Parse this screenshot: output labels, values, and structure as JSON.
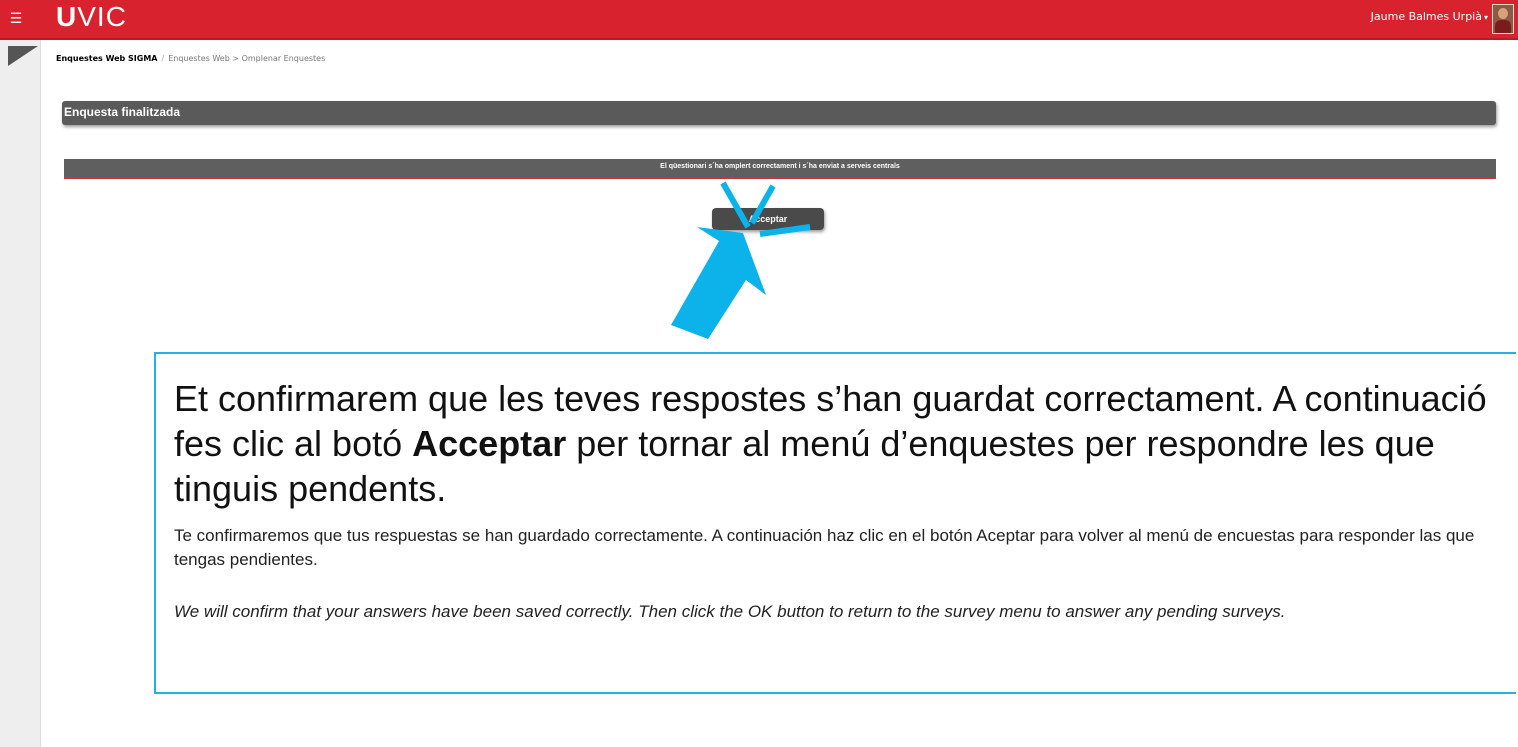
{
  "header": {
    "menu_icon": "hamburger-icon",
    "logo_u": "U",
    "logo_rest": "VIC",
    "user_name": "Jaume Balmes Urpià",
    "user_caret": "▾",
    "brand_color": "#d8232e"
  },
  "breadcrumb": {
    "home": "Enquestes Web SIGMA",
    "separator": "/",
    "path": "Enquestes Web > Omplenar Enquestes"
  },
  "panel": {
    "title": "Enquesta finalitzada",
    "notice": "El qüestionari s´ha omplert correctament i s´ha enviat a serveis centrals",
    "accept_label": "Acceptar"
  },
  "callout": {
    "catalan_part1": "Et confirmarem que les teves respostes s’han guardat correctament. A continuació fes clic al botó ",
    "catalan_bold": "Acceptar",
    "catalan_part2": " per tornar al menú d’enquestes per respondre les que tinguis pendents.",
    "spanish": "Te confirmaremos que tus respuestas se han guardado correctamente. A continuación haz clic en el botón Aceptar para volver al menú de encuestas para responder las que tengas pendientes.",
    "english": "We will confirm that your answers have been saved correctly. Then click the OK button to return to the survey menu to answer any pending surveys.",
    "accent_color": "#26b0e6"
  }
}
